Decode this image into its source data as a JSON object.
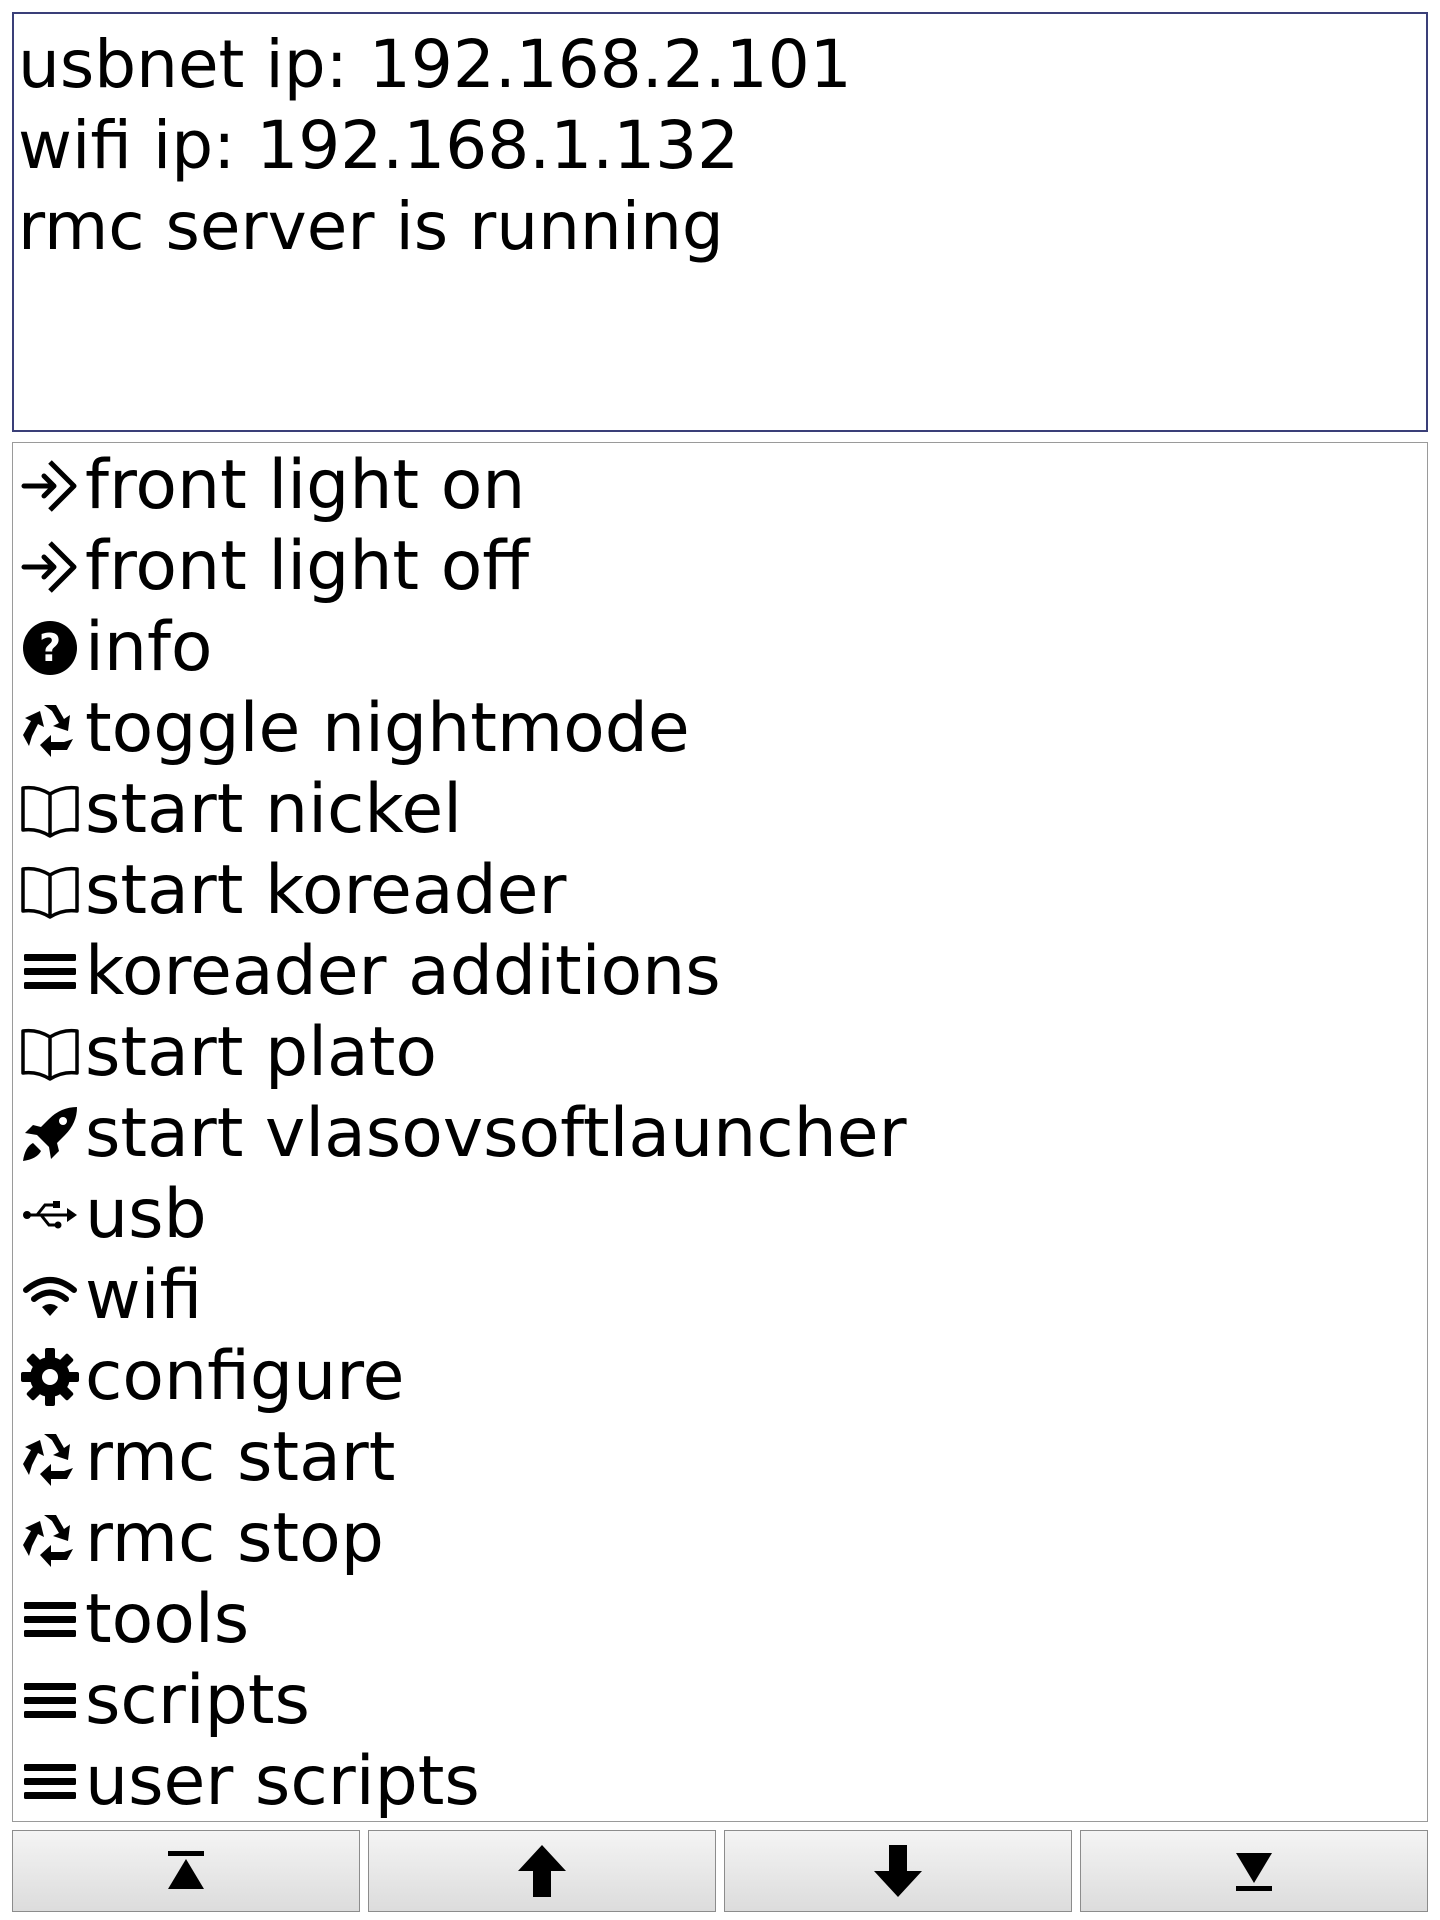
{
  "status": {
    "lines": [
      "usbnet ip: 192.168.2.101",
      "wifi ip: 192.168.1.132",
      "rmc server is running"
    ]
  },
  "menu": {
    "items": [
      {
        "label": "front light on",
        "icon": "enter-arrow-icon"
      },
      {
        "label": "front light off",
        "icon": "enter-arrow-icon"
      },
      {
        "label": "info",
        "icon": "question-circle-icon"
      },
      {
        "label": "toggle nightmode",
        "icon": "recycle-icon"
      },
      {
        "label": "start nickel",
        "icon": "open-book-icon"
      },
      {
        "label": "start koreader",
        "icon": "open-book-icon"
      },
      {
        "label": "koreader additions",
        "icon": "list-icon"
      },
      {
        "label": "start plato",
        "icon": "open-book-icon"
      },
      {
        "label": "start vlasovsoftlauncher",
        "icon": "rocket-icon"
      },
      {
        "label": "usb",
        "icon": "usb-icon"
      },
      {
        "label": "wifi",
        "icon": "wifi-icon"
      },
      {
        "label": "configure",
        "icon": "gear-icon"
      },
      {
        "label": "rmc start",
        "icon": "recycle-icon"
      },
      {
        "label": "rmc stop",
        "icon": "recycle-icon"
      },
      {
        "label": "tools",
        "icon": "list-icon"
      },
      {
        "label": "scripts",
        "icon": "list-icon"
      },
      {
        "label": "user scripts",
        "icon": "list-icon"
      }
    ]
  },
  "nav": {
    "buttons": [
      {
        "name": "first-page-button",
        "icon": "arrow-to-top-icon"
      },
      {
        "name": "page-up-button",
        "icon": "arrow-up-icon"
      },
      {
        "name": "page-down-button",
        "icon": "arrow-down-icon"
      },
      {
        "name": "last-page-button",
        "icon": "arrow-to-bottom-icon"
      }
    ]
  },
  "colors": {
    "status_border": "#3a3f78",
    "menu_border": "#9a9a9a",
    "text": "#000000",
    "button_face": "#e6e6e6"
  }
}
